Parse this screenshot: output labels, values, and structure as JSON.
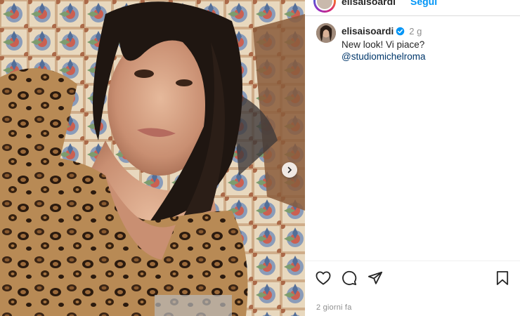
{
  "post": {
    "username": "elisaisoardi",
    "follow_label": "Segui",
    "time_ago": "2 g",
    "caption_line1": "New look! Vi piace?",
    "caption_mention": "@studiomichelroma",
    "date_label": "2 giorni fa"
  },
  "icons": {
    "like": "heart-icon",
    "comment": "comment-icon",
    "share": "send-icon",
    "save": "bookmark-icon",
    "verified": "verified-badge-icon",
    "next": "chevron-right-icon"
  },
  "colors": {
    "link_blue": "#0095f6",
    "mention": "#00376b",
    "muted": "#8e8e8e",
    "text": "#262626"
  }
}
